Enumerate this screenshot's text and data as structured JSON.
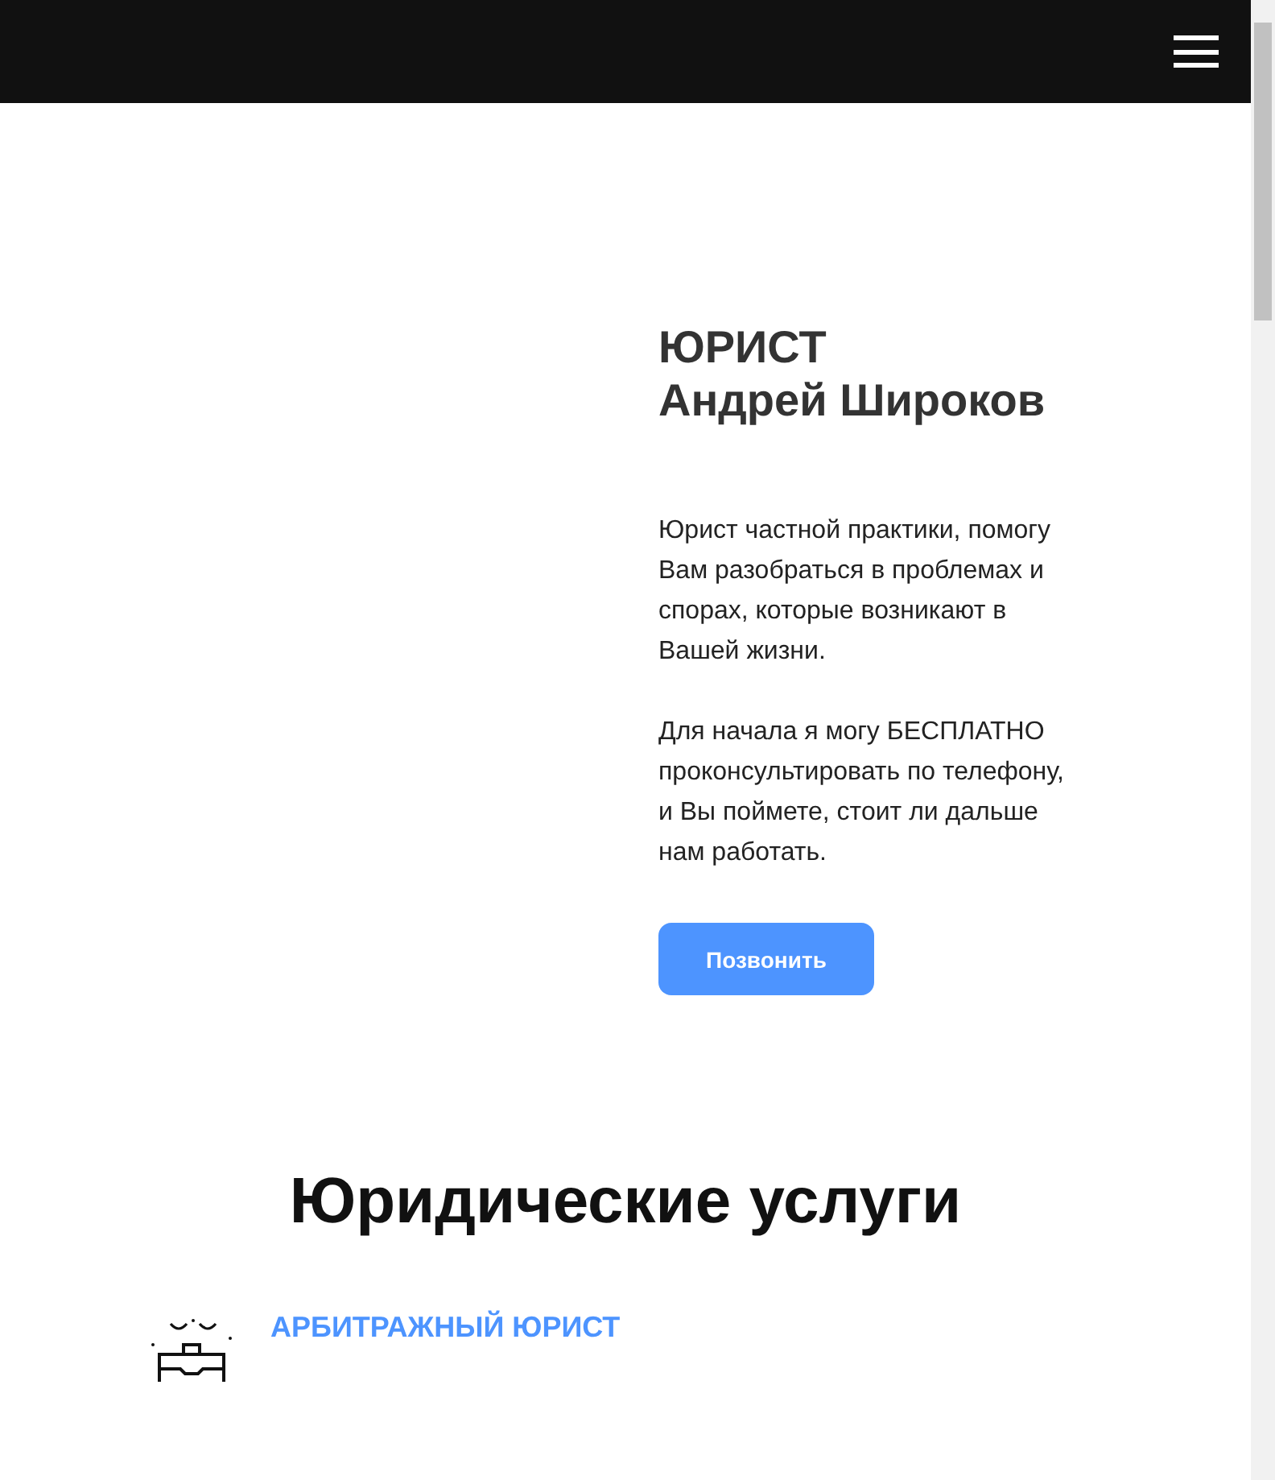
{
  "hero": {
    "title_lines": [
      "ЮРИСТ",
      "Андрей Широков"
    ],
    "paragraphs": [
      "Юрист частной практики, помогу Вам разобраться в проблемах и спорах, которые возникают в Вашей жизни.",
      "Для начала я могу БЕСПЛАТНО проконсультировать по телефону, и Вы поймете, стоит ли дальше нам работать."
    ],
    "button": "Позвонить"
  },
  "services": {
    "title": "Юридические услуги",
    "items": [
      {
        "title": "АРБИТРАЖНЫЙ ЮРИСТ"
      }
    ]
  }
}
